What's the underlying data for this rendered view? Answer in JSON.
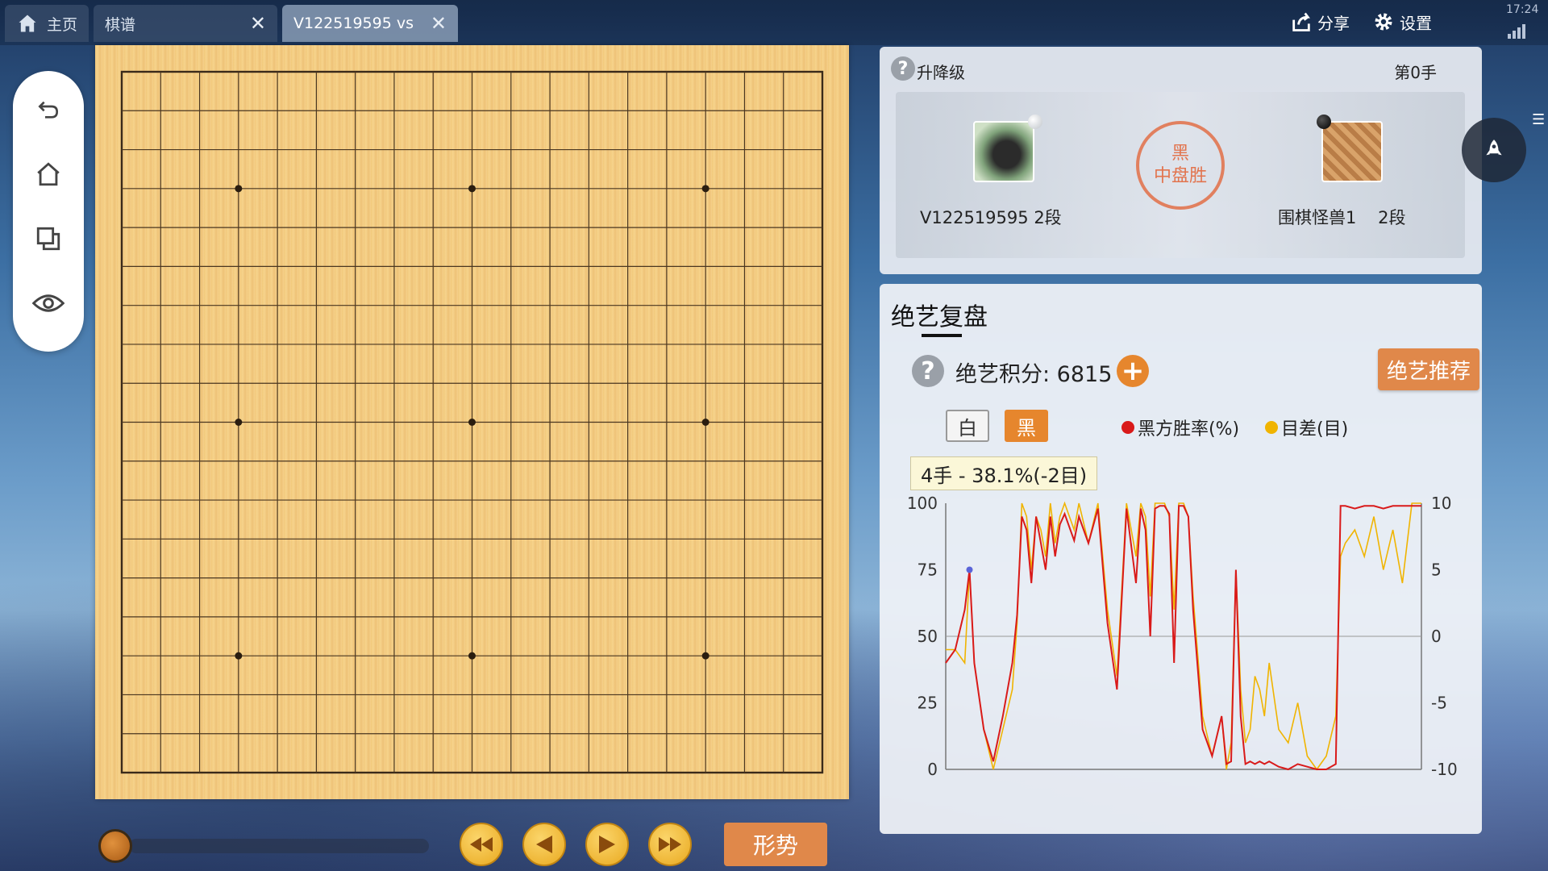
{
  "tabs": [
    {
      "label": "主页",
      "icon": "home-icon"
    },
    {
      "label": "棋谱"
    },
    {
      "label": "V122519595 vs"
    }
  ],
  "top_actions": {
    "share": "分享",
    "settings": "设置",
    "clock": "17:24"
  },
  "side_tools": [
    "undo-icon",
    "home-icon",
    "copy-icon",
    "eye-icon"
  ],
  "board": {
    "size": 19
  },
  "players": {
    "promotion_label": "升降级",
    "move_count": "第0手",
    "left": {
      "name": "V122519595",
      "rank": "2段",
      "stone": "white"
    },
    "right": {
      "name": "围棋怪兽1",
      "rank": "2段",
      "stone": "black"
    },
    "result_line1": "黑",
    "result_line2": "中盘胜"
  },
  "analysis": {
    "title": "绝艺复盘",
    "score_label": "绝艺积分: 6815",
    "recommend": "绝艺推荐",
    "toggle_white": "白",
    "toggle_black": "黑",
    "legend_winrate": "黑方胜率(%)",
    "legend_diff": "目差(目)",
    "tooltip": "4手 - 38.1%(-2目)",
    "colors": {
      "winrate": "#d91a1a",
      "diff": "#f0b400",
      "accent": "#e6862d"
    }
  },
  "controls": {
    "situation": "形势"
  },
  "chart_data": {
    "type": "line",
    "y_left_ticks": [
      "100",
      "75",
      "50",
      "25",
      "0"
    ],
    "y_right_ticks": [
      "10",
      "5",
      "0",
      "-5",
      "-10"
    ],
    "ylim_left": [
      0,
      100
    ],
    "ylim_right": [
      -10,
      10
    ],
    "x_range": [
      0,
      100
    ],
    "series": [
      {
        "name": "黑方胜率(%)",
        "color": "#d91a1a",
        "x": [
          0,
          2,
          4,
          5,
          6,
          8,
          10,
          12,
          14,
          15,
          16,
          17,
          18,
          19,
          20,
          21,
          22,
          23,
          24,
          25,
          27,
          28,
          30,
          32,
          34,
          36,
          38,
          40,
          41,
          42,
          43,
          44,
          45,
          46,
          47,
          48,
          49,
          50,
          51,
          52,
          54,
          56,
          58,
          59,
          60,
          61,
          62,
          63,
          64,
          65,
          66,
          67,
          68,
          70,
          72,
          74,
          76,
          78,
          80,
          82,
          83,
          84,
          86,
          88,
          90,
          92,
          94,
          96,
          98,
          100
        ],
        "y": [
          40,
          45,
          60,
          75,
          40,
          15,
          3,
          20,
          40,
          58,
          95,
          90,
          70,
          95,
          85,
          75,
          95,
          80,
          92,
          96,
          86,
          95,
          85,
          98,
          55,
          30,
          98,
          70,
          98,
          90,
          50,
          98,
          99,
          99,
          96,
          40,
          99,
          99,
          95,
          60,
          15,
          5,
          20,
          2,
          3,
          75,
          20,
          2,
          3,
          2,
          3,
          2,
          3,
          1,
          0,
          2,
          1,
          0,
          0,
          2,
          99,
          99,
          98,
          99,
          99,
          98,
          99,
          99,
          99,
          99
        ]
      },
      {
        "name": "目差(目)",
        "color": "#f0b400",
        "x": [
          0,
          2,
          4,
          5,
          6,
          8,
          10,
          12,
          14,
          15,
          16,
          17,
          18,
          19,
          20,
          21,
          22,
          23,
          24,
          25,
          27,
          28,
          30,
          32,
          34,
          36,
          38,
          40,
          41,
          42,
          43,
          44,
          45,
          46,
          47,
          48,
          49,
          50,
          51,
          52,
          54,
          56,
          58,
          59,
          60,
          61,
          62,
          63,
          64,
          65,
          66,
          67,
          68,
          70,
          72,
          74,
          76,
          78,
          80,
          82,
          83,
          84,
          86,
          88,
          90,
          92,
          94,
          96,
          98,
          100
        ],
        "y": [
          -1,
          -1,
          -2,
          5,
          -2,
          -7,
          -10,
          -7,
          -4,
          1,
          10,
          9,
          5,
          9,
          8,
          6,
          10,
          7,
          9,
          10,
          8,
          10,
          7,
          10,
          2,
          -3,
          10,
          6,
          10,
          9,
          3,
          10,
          10,
          10,
          9,
          2,
          10,
          10,
          9,
          3,
          -6,
          -9,
          -6,
          -10,
          -8,
          5,
          -4,
          -8,
          -7,
          -3,
          -4,
          -6,
          -2,
          -7,
          -8,
          -5,
          -9,
          -10,
          -9,
          -6,
          6,
          7,
          8,
          6,
          9,
          5,
          8,
          4,
          10,
          10
        ]
      }
    ]
  }
}
